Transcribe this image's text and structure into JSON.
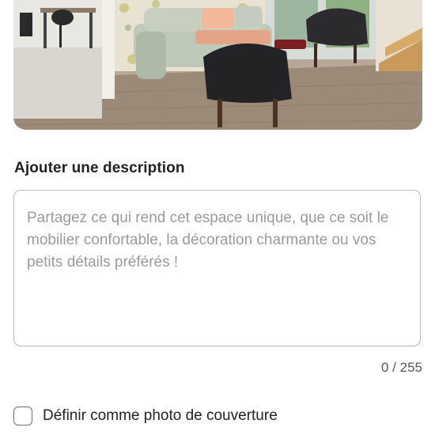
{
  "photo": {
    "alt_icon": "living-room-photo"
  },
  "description": {
    "title": "Ajouter une description",
    "value": "",
    "placeholder": "Partagez ce qui rend cet espace unique, que ce soit le mobilier confortable, la décoration charmante ou vos petits détails préférés !",
    "counter": "0 / 255"
  },
  "cover": {
    "label": "Définir comme photo de couverture",
    "checked": false
  }
}
